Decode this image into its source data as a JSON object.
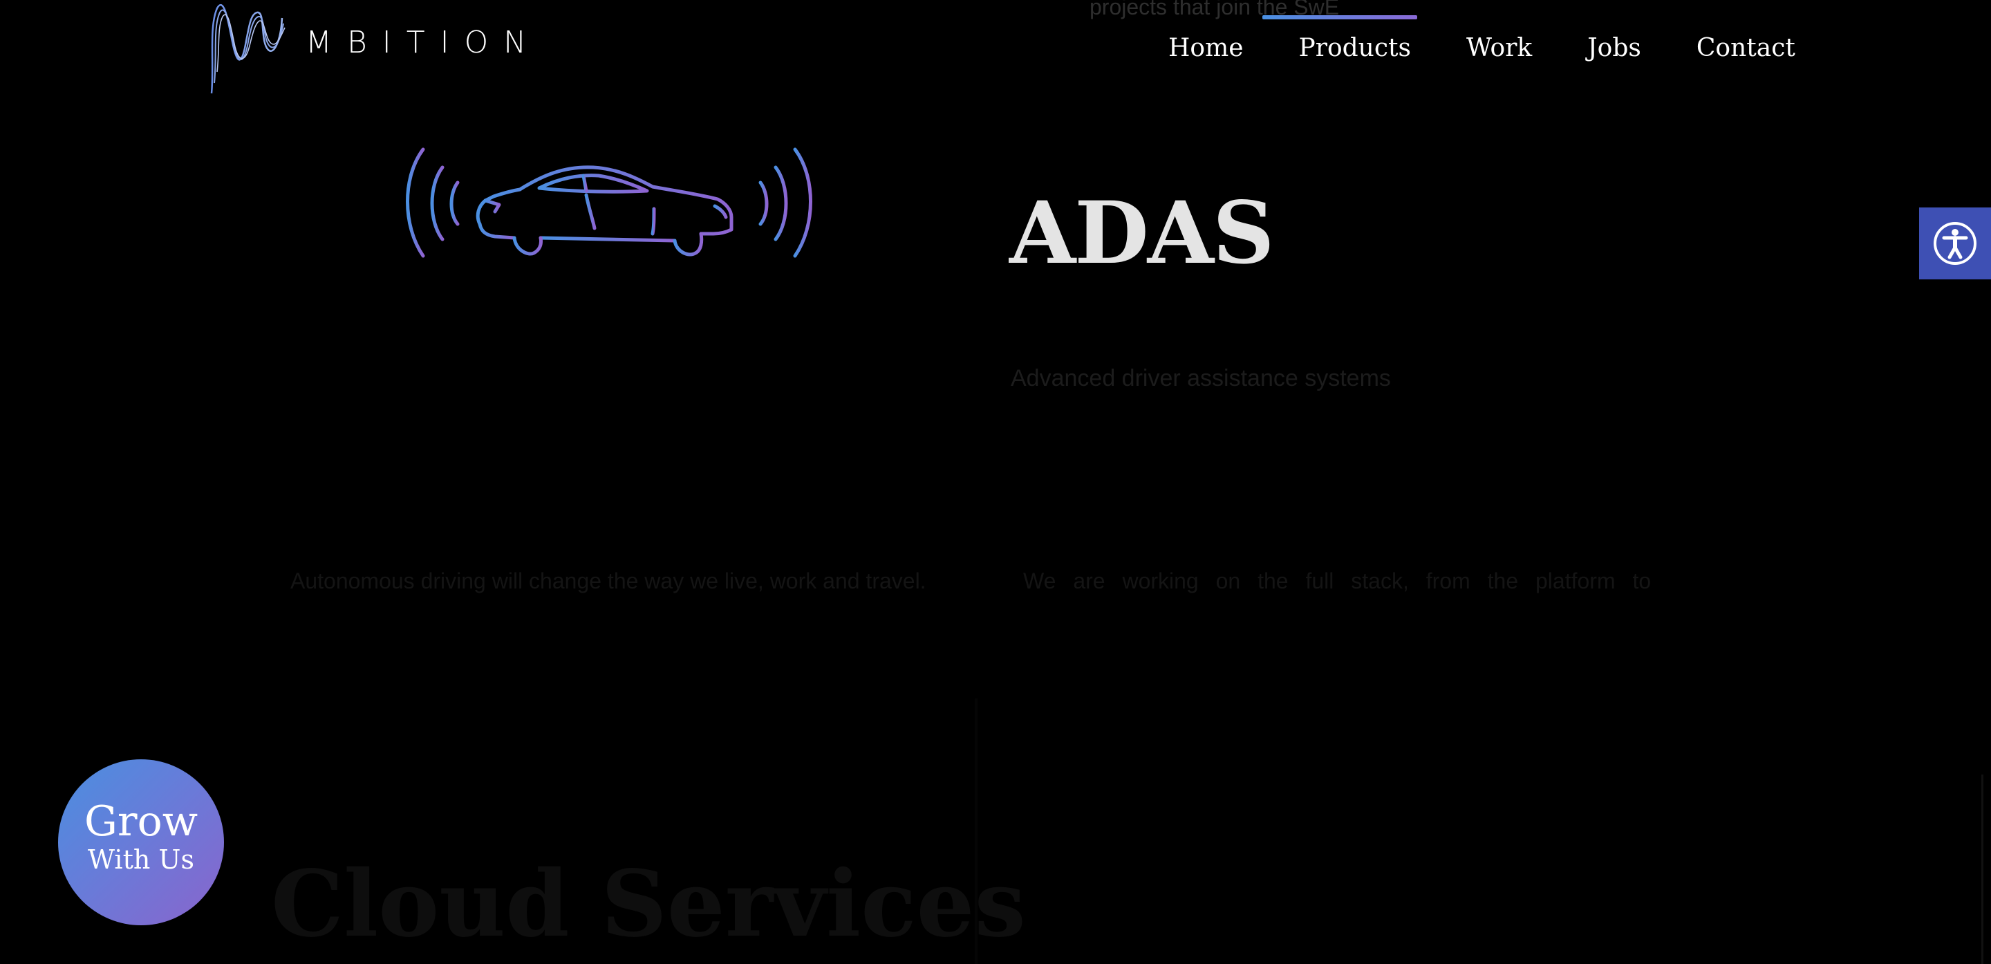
{
  "brand": {
    "logo_text": "MBITION",
    "logo_icon": "wave-logo-icon"
  },
  "header": {
    "faded_text": "projects that join the SwE",
    "nav": [
      {
        "label": "Home"
      },
      {
        "label": "Products"
      },
      {
        "label": "Work"
      },
      {
        "label": "Jobs"
      },
      {
        "label": "Contact"
      }
    ],
    "active_indicator_color_start": "#4a90e2",
    "active_indicator_color_end": "#8a6ad6"
  },
  "hero": {
    "illustration": "connected-car-icon",
    "title": "ADAS",
    "subtitle": "Advanced driver assistance systems"
  },
  "paragraphs": {
    "left": "Autonomous driving will change the way we live, work and travel.",
    "right": "We are working on the full stack, from the platform to"
  },
  "next_section": {
    "title": "Cloud Services"
  },
  "cta": {
    "line1": "Grow",
    "line2": "With Us",
    "gradient_start": "#4a8fe0",
    "gradient_end": "#8a64cc"
  },
  "accessibility": {
    "icon": "accessibility-icon",
    "color": "#3e50b4"
  }
}
